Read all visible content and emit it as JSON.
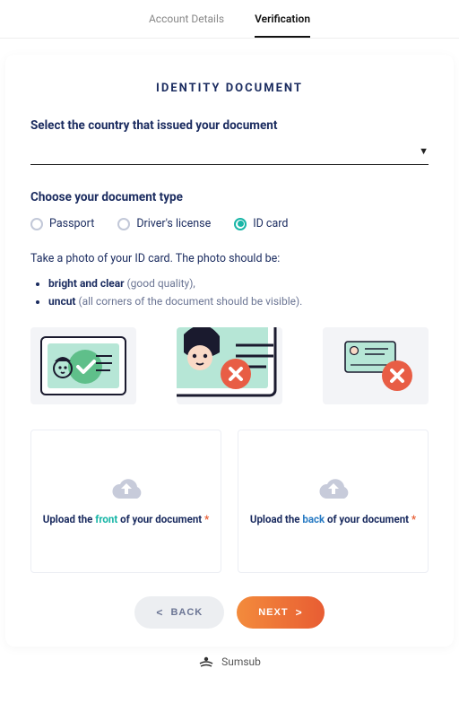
{
  "tabs": {
    "account": "Account Details",
    "verify": "Verification"
  },
  "title": "IDENTITY DOCUMENT",
  "countryLabel": "Select the country that issued your document",
  "docTypeLabel": "Choose your document type",
  "options": {
    "passport": "Passport",
    "drivers": "Driver's license",
    "idcard": "ID card"
  },
  "instruction": "Take a photo of your ID card. The photo should be:",
  "req": {
    "bright_b": "bright and clear",
    "bright_p": " (good quality),",
    "uncut_b": "uncut",
    "uncut_p": " (all corners of the document should be visible)."
  },
  "upload": {
    "front_pre": "Upload the ",
    "front_word": "front",
    "front_post": " of your document ",
    "back_pre": "Upload the ",
    "back_word": "back",
    "back_post": " of your document ",
    "ast": "*"
  },
  "buttons": {
    "back": "BACK",
    "next": "NEXT",
    "lt": "<",
    "gt": ">"
  },
  "footer": "Sumsub"
}
